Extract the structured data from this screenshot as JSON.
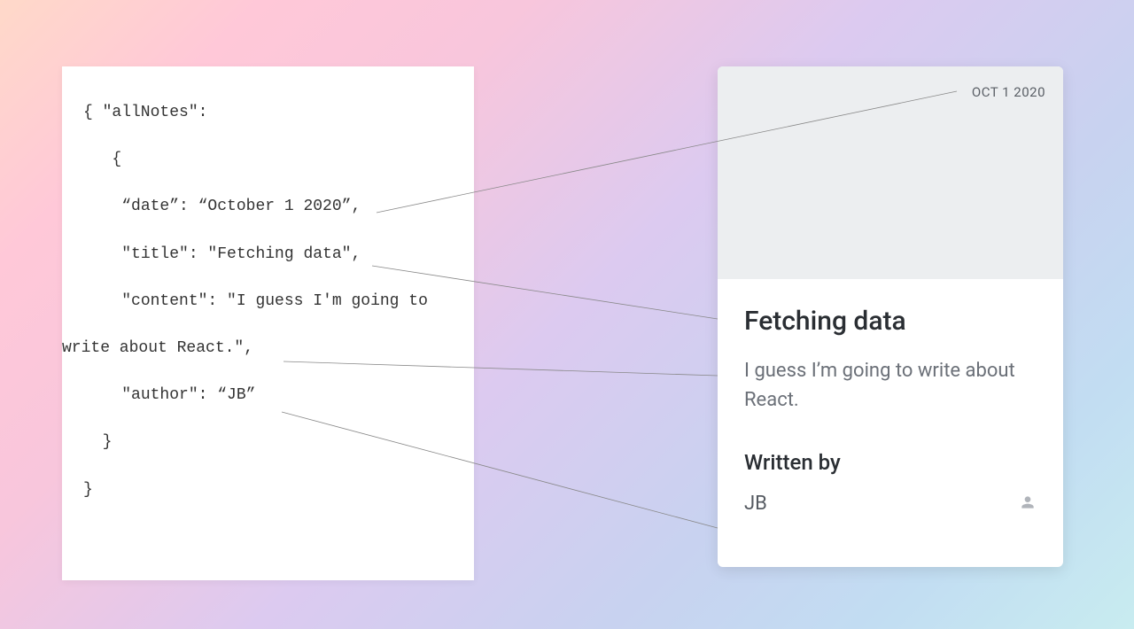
{
  "code": {
    "l1": "{ \"allNotes\":",
    "l2": "   {",
    "l3": "    “date”: “October 1 2020”,",
    "l4": "    \"title\": \"Fetching data\",",
    "l5": "    \"content\": \"I guess I'm going to",
    "l6": "write about React.\",",
    "l7": "    \"author\": “JB”",
    "l8": "  }",
    "l9": "}"
  },
  "card": {
    "date": "OCT 1 2020",
    "title": "Fetching data",
    "content": "I guess I’m going to write about React.",
    "writtenByLabel": "Written by",
    "author": "JB"
  }
}
